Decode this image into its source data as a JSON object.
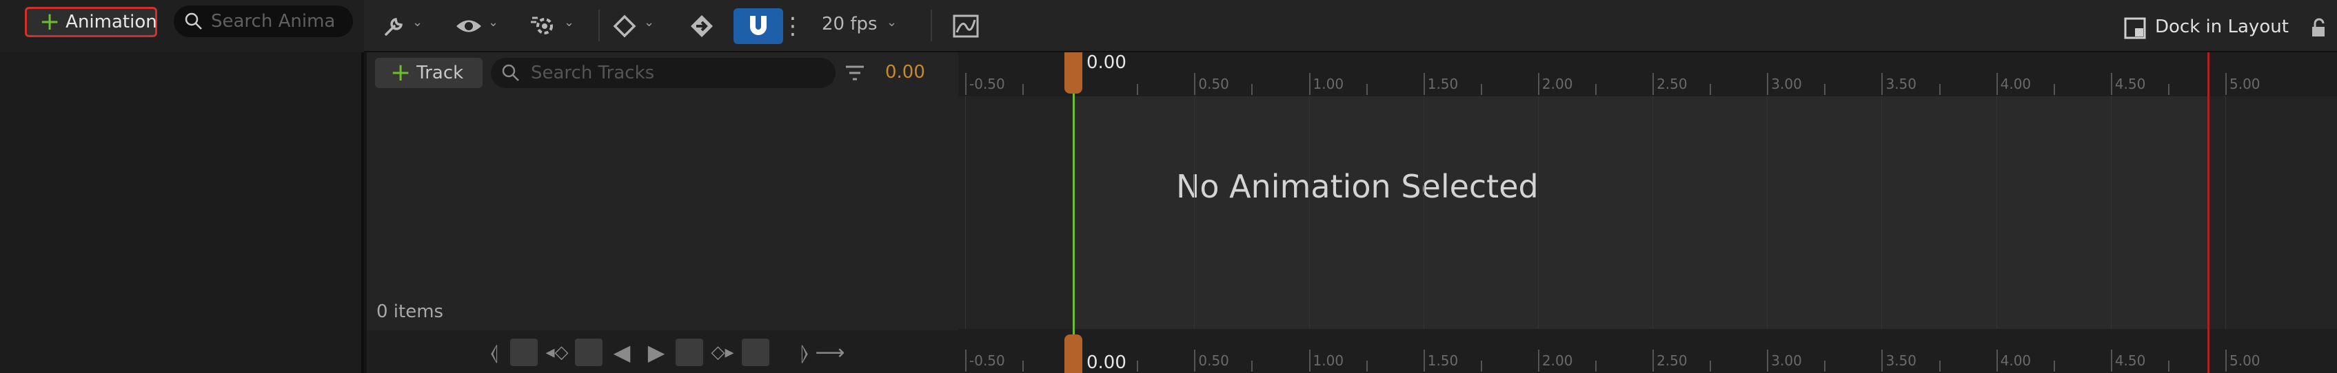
{
  "toolbar": {
    "add_animation_label": "Animation",
    "search_animations_placeholder": "Search Anima",
    "fps_label": "20 fps",
    "dock_label": "Dock in Layout"
  },
  "tracks": {
    "add_track_label": "Track",
    "search_tracks_placeholder": "Search Tracks",
    "current_time": "0.00",
    "items_count": "0 items"
  },
  "timeline": {
    "playhead_time": "0.00",
    "empty_message": "No Animation Selected",
    "ticks": [
      "-0.50",
      "0.50",
      "1.00",
      "1.50",
      "2.00",
      "2.50",
      "3.00",
      "3.50",
      "4.00",
      "4.50",
      "5.00"
    ]
  },
  "colors": {
    "accent_green": "#6dbf2e",
    "accent_orange": "#c8882c",
    "snap_blue": "#1d5fa8",
    "playhead_bg": "#b3622a",
    "end_marker": "#b02020",
    "highlight_red": "#d0302a"
  }
}
